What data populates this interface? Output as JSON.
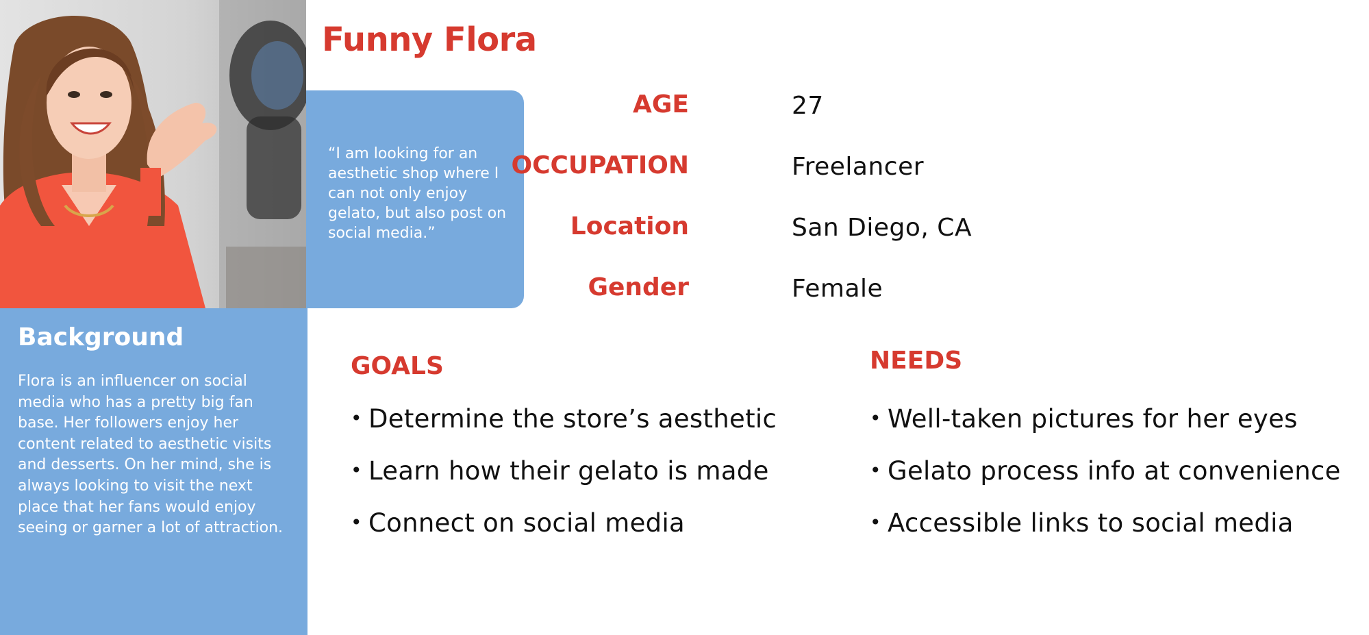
{
  "persona": {
    "name": "Funny Flora",
    "quote": "“I am looking for an aesthetic shop where I can not only enjoy gelato, but also post on social media.”"
  },
  "attributes": [
    {
      "label": "AGE",
      "value": "27"
    },
    {
      "label": "OCCUPATION",
      "value": "Freelancer"
    },
    {
      "label": "Location",
      "value": "San Diego, CA"
    },
    {
      "label": "Gender",
      "value": "Female"
    }
  ],
  "background": {
    "title": "Background",
    "text": "Flora is an influencer on social media who has a pretty big fan base. Her followers enjoy her content related to aesthetic visits and desserts. On her mind, she is always looking to visit the next place that her fans would enjoy seeing or garner a lot of attraction."
  },
  "goals": {
    "title": "GOALS",
    "items": [
      "Determine the store’s aesthetic",
      "Learn how their gelato is made",
      "Connect on social media"
    ]
  },
  "needs": {
    "title": "NEEDS",
    "items": [
      "Well-taken pictures for her eyes",
      "Gelato process info at convenience",
      "Accessible links to social media"
    ]
  },
  "colors": {
    "accent_red": "#d63a2f",
    "panel_blue": "#78aadd",
    "text_dark": "#111111"
  },
  "icons": {
    "bullet": "•"
  }
}
